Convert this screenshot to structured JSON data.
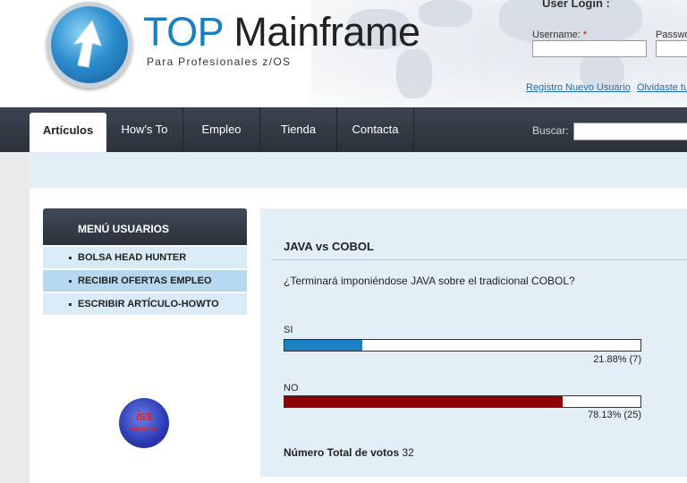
{
  "brand": {
    "title_accent": "TOP",
    "title_main": "Mainframe",
    "subtitle": "Para Profesionales z/OS"
  },
  "login": {
    "title": "User Login :",
    "username_label": "Username:",
    "username_required": "*",
    "password_label": "Password",
    "register_link": "Registro Nuevo Usuario",
    "forgot_link": "Olvidaste tu"
  },
  "nav": {
    "items": [
      "Artículos",
      "How's To",
      "Empleo",
      "Tienda",
      "Contacta"
    ],
    "active": "Artículos"
  },
  "search": {
    "label": "Buscar:",
    "value": ""
  },
  "menu": {
    "title": "MENÚ USUARIOS",
    "items": [
      "BOLSA HEAD HUNTER",
      "RECIBIR OFERTAS EMPLEO",
      "ESCRIBIR ARTÍCULO-HOWTO"
    ]
  },
  "sponsor": {
    "logo_text": "iss",
    "logo_subtext": "PROFESION"
  },
  "poll": {
    "title": "JAVA vs COBOL",
    "question": "¿Terminará imponiéndose JAVA sobre el tradicional COBOL?",
    "options": [
      {
        "label": "SI",
        "percent": 21.88,
        "result": "21.88% (7)",
        "color": "#1c7fc4"
      },
      {
        "label": "NO",
        "percent": 78.13,
        "result": "78.13% (25)",
        "color": "#8b0000"
      }
    ],
    "total_label": "Número Total de votos",
    "total_value": "32"
  }
}
